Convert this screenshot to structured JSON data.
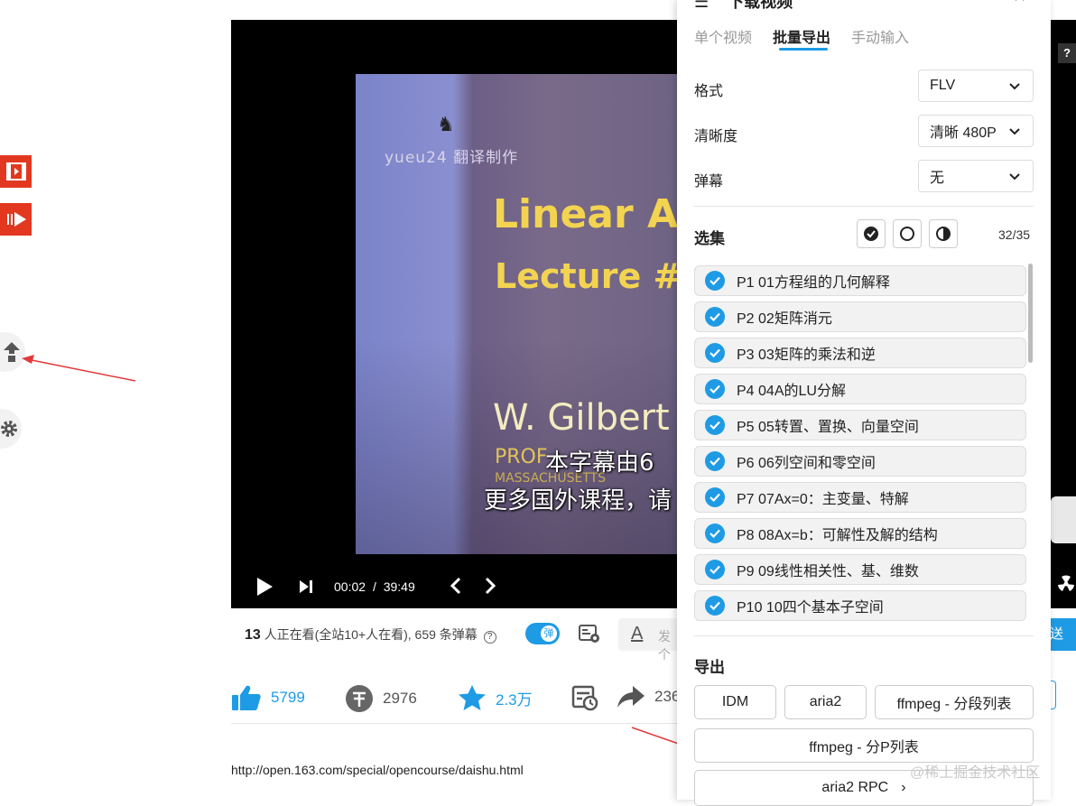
{
  "side": {
    "icons": [
      "video-icon",
      "play-forward-icon",
      "upload-icon",
      "settings-icon"
    ]
  },
  "video": {
    "watermark": "yueu24 翻译制作",
    "title_line1": "Linear A",
    "title_line2": "Lecture #",
    "author": "W. Gilbert",
    "sub_small": "PROF",
    "sub_small2": "MASSACHUSETTS",
    "subtitle1": "本字幕由6",
    "subtitle2": "更多国外课程，请",
    "time_current": "00:02",
    "time_sep": "/",
    "time_total": "39:49"
  },
  "info": {
    "viewers_count": "13",
    "viewers_text": "人正在看(全站10+人在看), 659 条弹幕",
    "danmaku_toggle": "弹",
    "input_placeholder": "发个",
    "send_label": "发送"
  },
  "actions": {
    "like": "5799",
    "coin": "2976",
    "fav": "2.3万",
    "share": "236"
  },
  "description": "http://open.163.com/special/opencourse/daishu.html",
  "watermark_site": "@稀土掘金技术社区",
  "panel": {
    "header_title": "下载视频",
    "tabs": [
      {
        "label": "单个视频"
      },
      {
        "label": "批量导出"
      },
      {
        "label": "手动输入"
      }
    ],
    "format_label": "格式",
    "format_value": "FLV",
    "quality_label": "清晰度",
    "quality_value": "清晰 480P",
    "danmaku_label": "弹幕",
    "danmaku_value": "无",
    "select_label": "选集",
    "select_count": "32/35",
    "episodes": [
      "P1 01方程组的几何解释",
      "P2 02矩阵消元",
      "P3 03矩阵的乘法和逆",
      "P4 04A的LU分解",
      "P5 05转置、置换、向量空间",
      "P6 06列空间和零空间",
      "P7 07Ax=0：主变量、特解",
      "P8 08Ax=b：可解性及解的结构",
      "P9 09线性相关性、基、维数",
      "P10 10四个基本子空间"
    ],
    "export_label": "导出",
    "export_buttons": [
      "IDM",
      "aria2",
      "ffmpeg - 分段列表",
      "ffmpeg - 分P列表",
      "aria2 RPC"
    ]
  },
  "colors": {
    "accent": "#1e9be4",
    "red": "#e2381f",
    "arrow": "#e03a3a"
  }
}
